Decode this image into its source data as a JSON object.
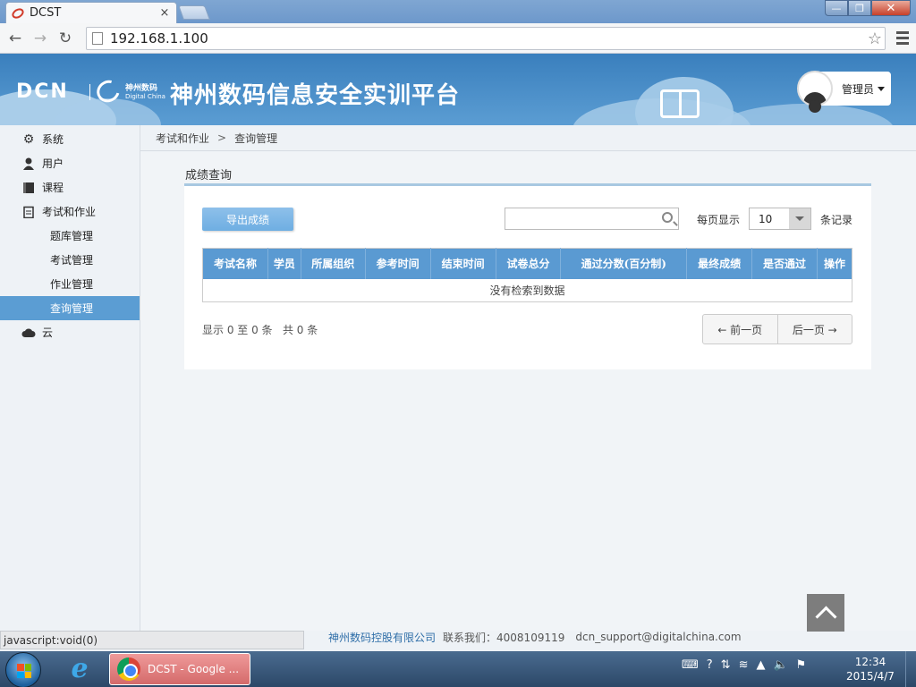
{
  "browser": {
    "tab_title": "DCST",
    "url": "192.168.1.100",
    "status_text": "javascript:void(0)"
  },
  "header": {
    "logo_text": "DCN",
    "brand_cn": "神州数码",
    "brand_en": "Digital China",
    "site_title": "神州数码信息安全实训平台",
    "user_name": "管理员"
  },
  "sidebar": {
    "items": [
      {
        "label": "系统",
        "icon": "gear-icon"
      },
      {
        "label": "用户",
        "icon": "user-icon"
      },
      {
        "label": "课程",
        "icon": "book-icon"
      },
      {
        "label": "考试和作业",
        "icon": "clipboard-icon"
      }
    ],
    "sub_items": [
      {
        "label": "题库管理",
        "active": false
      },
      {
        "label": "考试管理",
        "active": false
      },
      {
        "label": "作业管理",
        "active": false
      },
      {
        "label": "查询管理",
        "active": true
      }
    ],
    "cloud_item": {
      "label": "云",
      "icon": "cloud-icon"
    }
  },
  "breadcrumb": {
    "parent": "考试和作业",
    "separator": ">",
    "current": "查询管理"
  },
  "panel": {
    "title": "成绩查询",
    "export_label": "导出成绩",
    "search_value": "",
    "page_size_label": "每页显示",
    "page_size_value": "10",
    "records_label": "条记录",
    "columns": [
      "考试名称",
      "学员",
      "所属组织",
      "参考时间",
      "结束时间",
      "试卷总分",
      "通过分数(百分制)",
      "最终成绩",
      "是否通过",
      "操作"
    ],
    "empty_text": "没有检索到数据",
    "summary": "显示 0 至 0 条   共 0 条",
    "prev_label": "← 前一页",
    "next_label": "后一页 →"
  },
  "footer": {
    "company": "神州数码控股有限公司",
    "contact": "联系我们：4008109119",
    "email": "dcn_support@digitalchina.com"
  },
  "taskbar": {
    "chrome_task_label": "DCST - Google ...",
    "time": "12:34",
    "date": "2015/4/7"
  },
  "colors": {
    "header_blue": "#3a7fbd",
    "accent_blue": "#5b9dd3",
    "table_header": "#5a9ad2"
  }
}
